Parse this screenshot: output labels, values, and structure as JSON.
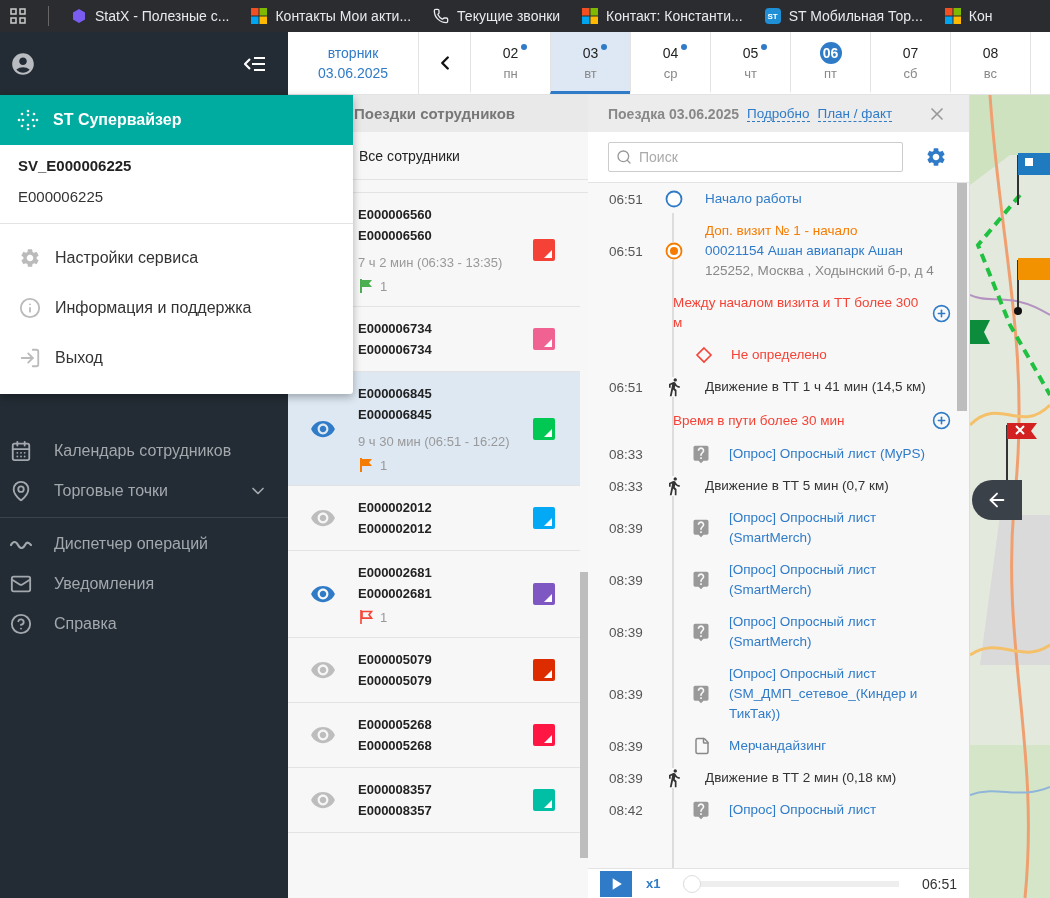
{
  "bookmarks": [
    {
      "label": "StatX - Полезные с..."
    },
    {
      "label": "Контакты Мои акти..."
    },
    {
      "label": "Текущие звонки"
    },
    {
      "label": "Контакт: Константи..."
    },
    {
      "label": "ST Мобильная Тор...",
      "badge": "ST"
    },
    {
      "label": "Кон"
    }
  ],
  "user_menu": {
    "app_name": "ST Супервайзер",
    "login": "SV_E000006225",
    "user_id": "E000006225",
    "items": [
      {
        "label": "Настройки сервиса"
      },
      {
        "label": "Информация и поддержка"
      },
      {
        "label": "Выход"
      }
    ]
  },
  "sidebar": {
    "groups": [
      [
        {
          "label": "Календарь сотрудников",
          "expandable": false
        },
        {
          "label": "Торговые точки",
          "expandable": true
        }
      ],
      [
        {
          "label": "Диспетчер операций",
          "expandable": false
        },
        {
          "label": "Уведомления",
          "expandable": false
        },
        {
          "label": "Справка",
          "expandable": false
        }
      ]
    ]
  },
  "date_bar": {
    "weekday": "вторник",
    "date": "03.06.2025",
    "days": [
      {
        "day": "02",
        "weekday": "пн",
        "selected": false,
        "today": false,
        "has_trips": true
      },
      {
        "day": "03",
        "weekday": "вт",
        "selected": true,
        "today": false,
        "has_trips": true
      },
      {
        "day": "04",
        "weekday": "ср",
        "selected": false,
        "today": false,
        "has_trips": true
      },
      {
        "day": "05",
        "weekday": "чт",
        "selected": false,
        "today": false,
        "has_trips": true
      },
      {
        "day": "06",
        "weekday": "пт",
        "selected": false,
        "today": true,
        "has_trips": false
      },
      {
        "day": "07",
        "weekday": "сб",
        "selected": false,
        "today": false,
        "has_trips": false
      },
      {
        "day": "08",
        "weekday": "вс",
        "selected": false,
        "today": false,
        "has_trips": false
      }
    ]
  },
  "employees": {
    "title": "Поездки сотрудников",
    "filter": "Все сотрудники",
    "rows": [
      {
        "code": "E000006560",
        "name": "E000006560",
        "duration": "7 ч 2 мин (06:33 - 13:35)",
        "flag": {
          "kind": "filled",
          "color": "#4caf50",
          "count": "1"
        },
        "color": "#f44336",
        "selected": false
      },
      {
        "code": "E000006734",
        "name": "E000006734",
        "color": "#f06292",
        "selected": false
      },
      {
        "code": "E000006845",
        "name": "E000006845",
        "on_map": true,
        "duration": "9 ч 30 мин (06:51 - 16:22)",
        "flag": {
          "kind": "filled",
          "color": "#f57c00",
          "count": "1"
        },
        "color": "#00c853",
        "selected": true
      },
      {
        "code": "E000002012",
        "name": "E000002012",
        "on_map": false,
        "color": "#03a9f4",
        "selected": false
      },
      {
        "code": "E000002681",
        "name": "E000002681",
        "on_map": true,
        "flag": {
          "kind": "outline",
          "color": "#f44336",
          "count": "1"
        },
        "color": "#7e57c2",
        "selected": false
      },
      {
        "code": "E000005079",
        "name": "E000005079",
        "on_map": false,
        "color": "#dd2c00",
        "selected": false
      },
      {
        "code": "E000005268",
        "name": "E000005268",
        "on_map": false,
        "color": "#ff1744",
        "selected": false
      },
      {
        "code": "E000008357",
        "name": "E000008357",
        "on_map": false,
        "color": "#00bfa5",
        "selected": false
      }
    ]
  },
  "trip": {
    "title": "Поездка 03.06.2025",
    "links": [
      "Подробно",
      "План / факт"
    ],
    "search": {
      "placeholder": "Поиск"
    },
    "events": [
      {
        "kind": "start",
        "time": "06:51",
        "text": "Начало работы"
      },
      {
        "kind": "visit",
        "time": "06:51",
        "title": "Доп. визит № 1 - начало",
        "text": "00021154 Ашан авиапарк Ашан",
        "address": "125252, Москва , Ходынский б-р, д 4"
      },
      {
        "kind": "warning",
        "text": "Между началом визита и ТТ более 300 м"
      },
      {
        "kind": "status",
        "text": "Не определено"
      },
      {
        "kind": "move",
        "time": "06:51",
        "text": "Движение в ТТ 1 ч 41 мин (14,5 км)"
      },
      {
        "kind": "warning",
        "text": "Время в пути более 30 мин"
      },
      {
        "kind": "survey",
        "time": "08:33",
        "text": "[Опрос] Опросный лист (MyPS)"
      },
      {
        "kind": "move",
        "time": "08:33",
        "text": "Движение в ТТ 5 мин (0,7 км)"
      },
      {
        "kind": "survey",
        "time": "08:39",
        "text": "[Опрос] Опросный лист (SmartMerch)"
      },
      {
        "kind": "survey",
        "time": "08:39",
        "text": "[Опрос] Опросный лист (SmartMerch)"
      },
      {
        "kind": "survey",
        "time": "08:39",
        "text": "[Опрос] Опросный лист (SmartMerch)"
      },
      {
        "kind": "survey",
        "time": "08:39",
        "text": "[Опрос] Опросный лист (SM_ДМП_сетевое_(Киндер и ТикТак))"
      },
      {
        "kind": "document",
        "time": "08:39",
        "text": "Мерчандайзинг"
      },
      {
        "kind": "move",
        "time": "08:39",
        "text": "Движение в ТТ 2 мин (0,18 км)"
      },
      {
        "kind": "survey",
        "time": "08:42",
        "text": "[Опрос] Опросный лист"
      }
    ],
    "player": {
      "speed": "x1",
      "level": 0,
      "time": "06:51"
    }
  }
}
